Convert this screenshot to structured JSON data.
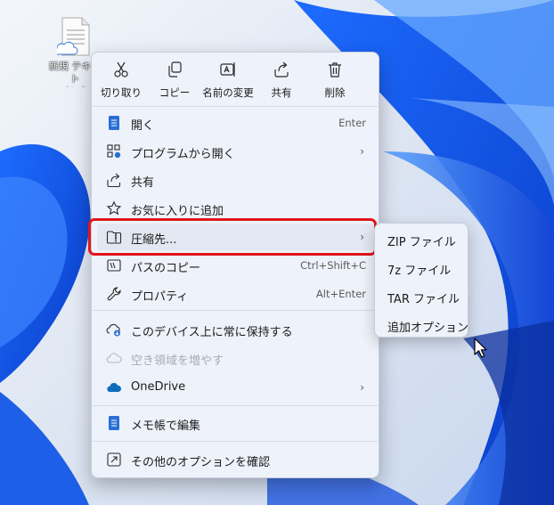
{
  "desktop": {
    "icon_label": "新規 テキスト\nメント"
  },
  "toolbar": {
    "cut": "切り取り",
    "copy": "コピー",
    "rename": "名前の変更",
    "share": "共有",
    "delete": "削除"
  },
  "menu": {
    "open": {
      "label": "開く",
      "shortcut": "Enter"
    },
    "open_with": {
      "label": "プログラムから開く"
    },
    "share": {
      "label": "共有"
    },
    "favorites": {
      "label": "お気に入りに追加"
    },
    "compress": {
      "label": "圧縮先..."
    },
    "copy_path": {
      "label": "パスのコピー",
      "shortcut": "Ctrl+Shift+C"
    },
    "properties": {
      "label": "プロパティ",
      "shortcut": "Alt+Enter"
    },
    "keep_on_device": {
      "label": "このデバイス上に常に保持する"
    },
    "free_space": {
      "label": "空き領域を増やす"
    },
    "onedrive": {
      "label": "OneDrive"
    },
    "edit_notepad": {
      "label": "メモ帳で編集"
    },
    "more_options": {
      "label": "その他のオプションを確認"
    },
    "chevron": "›"
  },
  "submenu": {
    "items": [
      "ZIP ファイル",
      "7z ファイル",
      "TAR ファイル",
      "追加オプション"
    ]
  },
  "colors": {
    "highlight": "#e0161c",
    "accent": "#0067c0",
    "onedrive": "#0f6cbd"
  }
}
